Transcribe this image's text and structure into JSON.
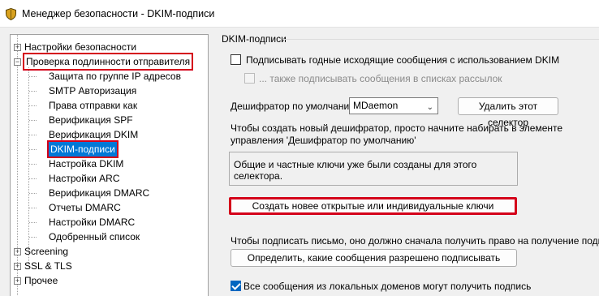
{
  "window": {
    "title": "Менеджер безопасности - DKIM-подписи",
    "icon": "shield-icon"
  },
  "tree": {
    "items": [
      {
        "label": "Настройки безопасности",
        "expander": "+"
      },
      {
        "label": "Проверка подлинности отправителя",
        "expander": "−"
      },
      {
        "label": "Защита по группе IP адресов"
      },
      {
        "label": "SMTP Авторизация"
      },
      {
        "label": "Права отправки как"
      },
      {
        "label": "Верификация SPF"
      },
      {
        "label": "Верификация DKIM"
      },
      {
        "label": "DKIM-подписи"
      },
      {
        "label": "Настройка DKIM"
      },
      {
        "label": "Настройки ARC"
      },
      {
        "label": "Верификация DMARC"
      },
      {
        "label": "Отчеты DMARC"
      },
      {
        "label": "Настройки DMARC"
      },
      {
        "label": "Одобренный список"
      },
      {
        "label": "Screening",
        "expander": "+"
      },
      {
        "label": "SSL & TLS",
        "expander": "+"
      },
      {
        "label": "Прочее",
        "expander": "+"
      }
    ]
  },
  "dkim": {
    "group_title": "DKIM-подписи",
    "sign_outgoing_label": "Подписывать годные исходящие сообщения с использованием DKIM",
    "sign_lists_label": "... также подписывать сообщения в списках рассылок",
    "default_selector_label": "Дешифратор по умолчанию",
    "default_selector_value": "MDaemon",
    "delete_selector_button": "Удалить этот селектор",
    "new_selector_hint": "Чтобы создать новый дешифратор, просто начните набирать в элементе управления 'Дешифратор по умолчанию'",
    "keys_status": "Общие и частные ключи уже были созданы для этого селектора.",
    "create_keys_button": "Создать новее открытые или индивидуальные ключи",
    "permission_hint": "Чтобы подписать письмо, оно должно сначала получить право на получение подписи.",
    "define_button": "Определить, какие сообщения разрешено подписывать",
    "local_domains_label": "Все сообщения из локальных доменов могут получить подпись"
  },
  "colors": {
    "highlight_red": "#d4001a",
    "selection_blue": "#0078d7",
    "checkbox_blue": "#0067c0"
  }
}
